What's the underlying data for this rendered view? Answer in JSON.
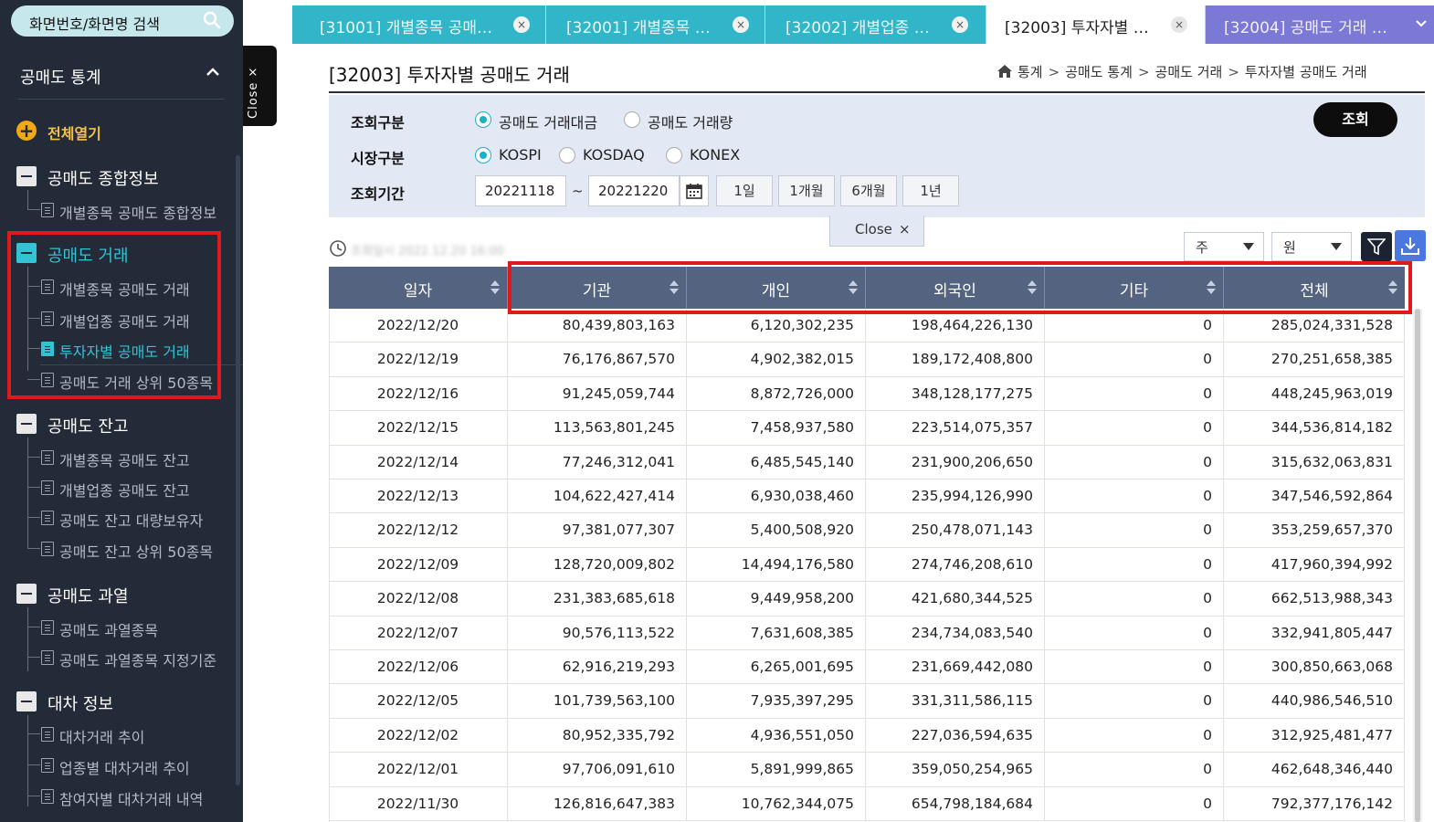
{
  "search": {
    "placeholder": "화면번호/화면명 검색"
  },
  "sidebar": {
    "title": "공매도 통계",
    "expand_all": "전체열기",
    "groups": [
      {
        "label": "공매도 종합정보",
        "items": [
          "개별종목 공매도 종합정보"
        ]
      },
      {
        "label": "공매도 거래",
        "items": [
          "개별종목 공매도 거래",
          "개별업종 공매도 거래",
          "투자자별 공매도 거래",
          "공매도 거래 상위 50종목"
        ]
      },
      {
        "label": "공매도 잔고",
        "items": [
          "개별종목 공매도 잔고",
          "개별업종 공매도 잔고",
          "공매도 잔고 대량보유자",
          "공매도 잔고 상위 50종목"
        ]
      },
      {
        "label": "공매도 과열",
        "items": [
          "공매도 과열종목",
          "공매도 과열종목 지정기준"
        ]
      },
      {
        "label": "대차 정보",
        "items": [
          "대차거래 추이",
          "업종별 대차거래 추이",
          "참여자별 대차거래 내역"
        ]
      }
    ],
    "close_tab": "Close ×"
  },
  "tabs": [
    {
      "label": "[31001] 개별종목 공매…"
    },
    {
      "label": "[32001] 개별종목 …"
    },
    {
      "label": "[32002] 개별업종 …"
    },
    {
      "label": "[32003] 투자자별 …"
    },
    {
      "label": "[32004] 공매도 거래 …"
    }
  ],
  "tab_close": "×",
  "page": {
    "title": "[32003] 투자자별 공매도 거래",
    "breadcrumb": [
      "통계",
      "공매도 통계",
      "공매도 거래",
      "투자자별 공매도 거래"
    ],
    "breadcrumb_sep": ">"
  },
  "filters": {
    "query_type_label": "조회구분",
    "query_type_options": [
      "공매도 거래대금",
      "공매도 거래량"
    ],
    "market_label": "시장구분",
    "market_options": [
      "KOSPI",
      "KOSDAQ",
      "KONEX"
    ],
    "period_label": "조회기간",
    "start_date": "20221118",
    "end_date": "20221220",
    "tilde": "~",
    "period_buttons": [
      "1일",
      "1개월",
      "6개월",
      "1년"
    ],
    "search_button": "조회",
    "close_label": "Close",
    "close_x": "×"
  },
  "toolbar": {
    "timestamp": "조회일시 2022.12.20 16:00",
    "period_unit": "주",
    "currency_unit": "원"
  },
  "colors": {
    "sidebar_bg": "#232a38",
    "accent": "#32c3d4",
    "tab_bg": "#31b5c8",
    "tab_overflow_bg": "#7c78d6",
    "header_bg": "#536380",
    "highlight": "#e01a1a"
  },
  "table": {
    "columns": [
      "일자",
      "기관",
      "개인",
      "외국인",
      "기타",
      "전체"
    ],
    "rows": [
      [
        "2022/12/20",
        "80,439,803,163",
        "6,120,302,235",
        "198,464,226,130",
        "0",
        "285,024,331,528"
      ],
      [
        "2022/12/19",
        "76,176,867,570",
        "4,902,382,015",
        "189,172,408,800",
        "0",
        "270,251,658,385"
      ],
      [
        "2022/12/16",
        "91,245,059,744",
        "8,872,726,000",
        "348,128,177,275",
        "0",
        "448,245,963,019"
      ],
      [
        "2022/12/15",
        "113,563,801,245",
        "7,458,937,580",
        "223,514,075,357",
        "0",
        "344,536,814,182"
      ],
      [
        "2022/12/14",
        "77,246,312,041",
        "6,485,545,140",
        "231,900,206,650",
        "0",
        "315,632,063,831"
      ],
      [
        "2022/12/13",
        "104,622,427,414",
        "6,930,038,460",
        "235,994,126,990",
        "0",
        "347,546,592,864"
      ],
      [
        "2022/12/12",
        "97,381,077,307",
        "5,400,508,920",
        "250,478,071,143",
        "0",
        "353,259,657,370"
      ],
      [
        "2022/12/09",
        "128,720,009,802",
        "14,494,176,580",
        "274,746,208,610",
        "0",
        "417,960,394,992"
      ],
      [
        "2022/12/08",
        "231,383,685,618",
        "9,449,958,200",
        "421,680,344,525",
        "0",
        "662,513,988,343"
      ],
      [
        "2022/12/07",
        "90,576,113,522",
        "7,631,608,385",
        "234,734,083,540",
        "0",
        "332,941,805,447"
      ],
      [
        "2022/12/06",
        "62,916,219,293",
        "6,265,001,695",
        "231,669,442,080",
        "0",
        "300,850,663,068"
      ],
      [
        "2022/12/05",
        "101,739,563,100",
        "7,935,397,295",
        "331,311,586,115",
        "0",
        "440,986,546,510"
      ],
      [
        "2022/12/02",
        "80,952,335,792",
        "4,936,551,050",
        "227,036,594,635",
        "0",
        "312,925,481,477"
      ],
      [
        "2022/12/01",
        "97,706,091,610",
        "5,891,999,865",
        "359,050,254,965",
        "0",
        "462,648,346,440"
      ],
      [
        "2022/11/30",
        "126,816,647,383",
        "10,762,344,075",
        "654,798,184,684",
        "0",
        "792,377,176,142"
      ]
    ]
  }
}
